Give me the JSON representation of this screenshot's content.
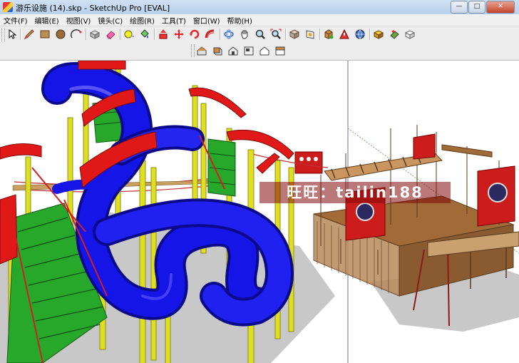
{
  "window": {
    "title": "游乐设施 (14).skp - SketchUp Pro [EVAL]",
    "minimize_label": "—",
    "maximize_label": "□",
    "close_label": "✕"
  },
  "menu": [
    {
      "label": "文件(F)"
    },
    {
      "label": "编辑(E)"
    },
    {
      "label": "视图(V)"
    },
    {
      "label": "镜头(C)"
    },
    {
      "label": "绘图(R)"
    },
    {
      "label": "工具(T)"
    },
    {
      "label": "窗口(W)"
    },
    {
      "label": "帮助(H)"
    }
  ],
  "toolbar_main": [
    "select-icon",
    "pencil-icon",
    "rectangle-icon",
    "circle-icon",
    "arc-icon",
    "make-component-icon",
    "eraser-icon",
    "tape-measure-icon",
    "paint-bucket-icon",
    "push-pull-icon",
    "move-icon",
    "rotate-icon",
    "follow-me-icon",
    "orbit-icon",
    "pan-icon",
    "zoom-icon",
    "zoom-extents-icon",
    "texture-position-icon",
    "section-plane-icon",
    "walk-icon",
    "position-camera-icon",
    "look-around-icon",
    "components-icon",
    "materials-icon",
    "styles-icon"
  ],
  "toolbar_views": [
    "iso-view-icon",
    "top-view-icon",
    "front-view-icon",
    "right-view-icon",
    "back-view-icon",
    "left-view-icon"
  ],
  "viewport": {
    "watermark": "旺旺：tailin188"
  },
  "colors": {
    "slide_blue": "#1313e0",
    "roof_red": "#e01818",
    "post_yellow": "#dede22",
    "deck_green": "#27a82a",
    "wood_brown": "#9b6a3a",
    "panel_red": "#cc1c1c",
    "shadow_gray": "#c6c6c6"
  }
}
